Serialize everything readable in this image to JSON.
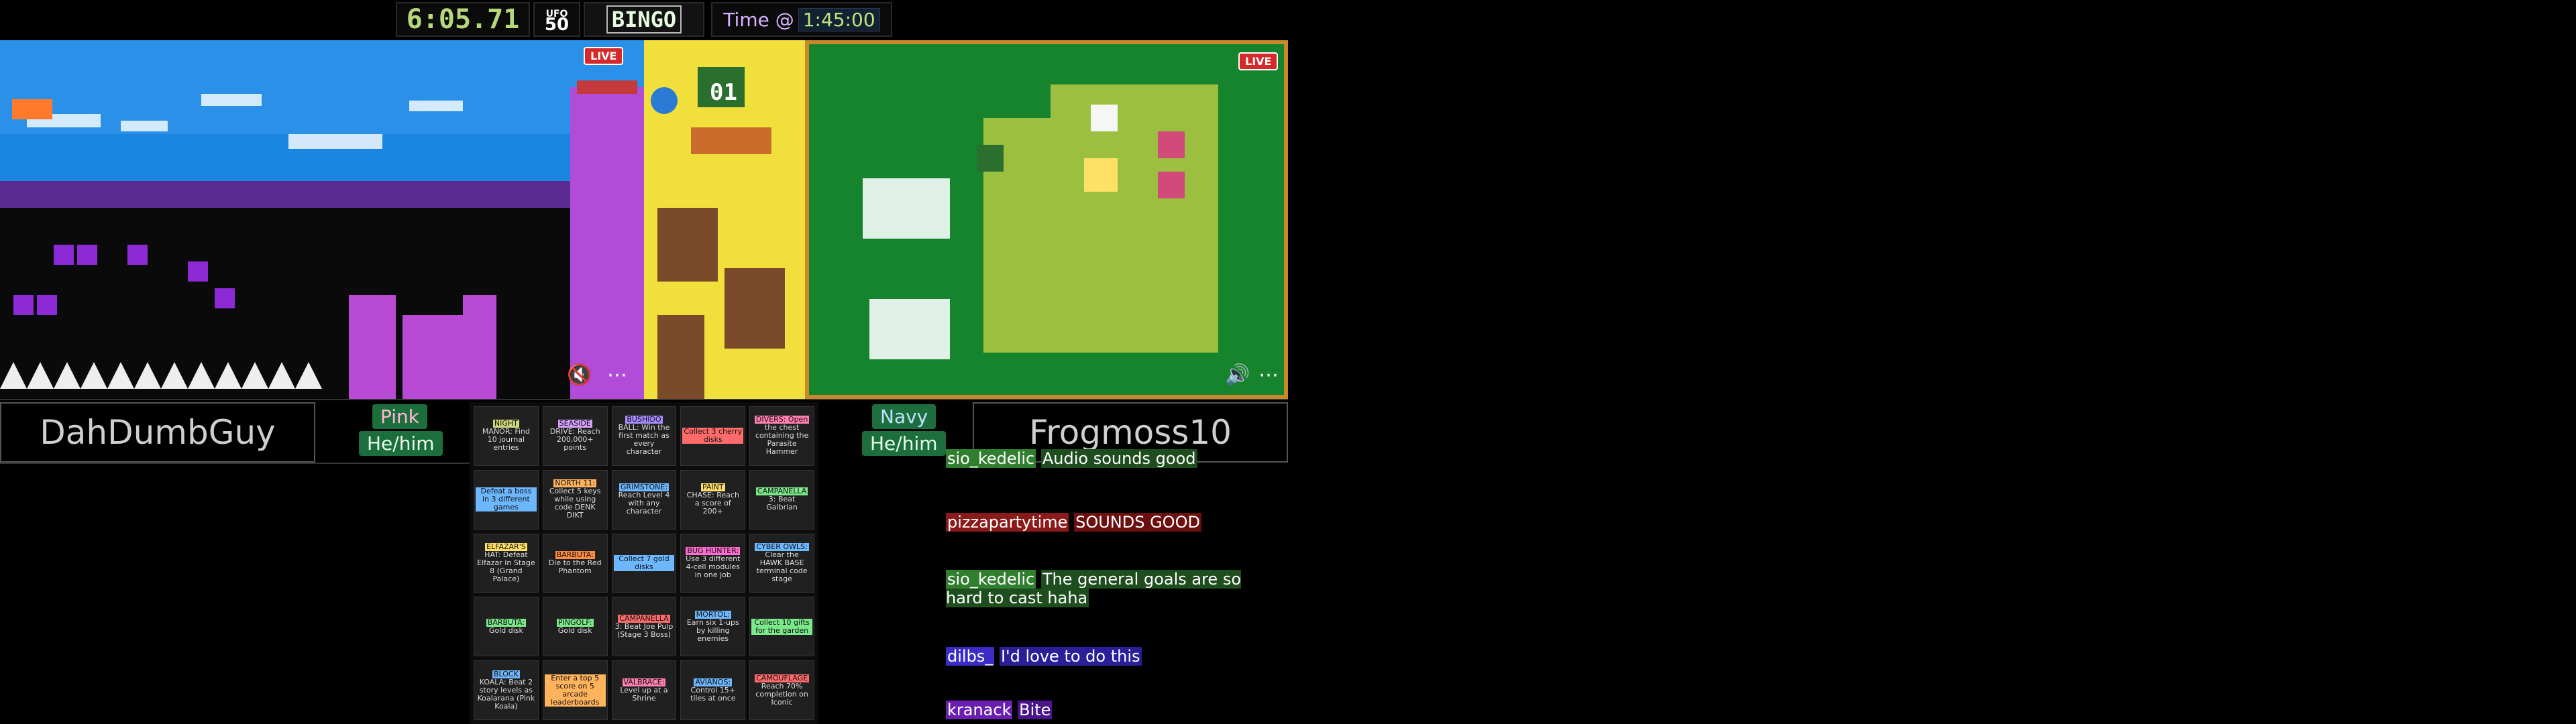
{
  "topbar": {
    "timer": "6:05.71",
    "logo": {
      "line1": "UFO",
      "line2": "50"
    },
    "title": "BINGO",
    "race_label": "Time @",
    "race_time": "1:45:00"
  },
  "games": {
    "left": {
      "live": "LIVE"
    },
    "right": {
      "live": "LIVE"
    },
    "middle": {
      "counter": "01"
    }
  },
  "players": {
    "left": {
      "name": "DahDumbGuy",
      "color": "Pink",
      "pronouns": "He/him"
    },
    "right": {
      "name": "Frogmoss10",
      "color": "Navy",
      "pronouns": "He/him"
    }
  },
  "board": {
    "cells": [
      {
        "title": "NIGHT",
        "body": "MANOR: Find 10 journal entries",
        "color": "#cfd87a"
      },
      {
        "title": "SEASIDE",
        "body": "DRIVE: Reach 200,000+ points",
        "color": "#d8a1ff"
      },
      {
        "title": "BUSHIDO",
        "body": "BALL: Win the first match as every character",
        "color": "#a78bff"
      },
      {
        "title": "",
        "body": "Collect 3 cherry disks",
        "color": "#ff6b6b"
      },
      {
        "title": "DIVERS: Open",
        "body": "the chest containing the Parasite Hammer",
        "color": "#ff7fb0"
      },
      {
        "title": "",
        "body": "Defeat a boss in 3 different games",
        "color": "#6db7ff"
      },
      {
        "title": "NORTH 11:",
        "body": "Collect 5 keys while using code DENK DIKT",
        "color": "#ffb35c"
      },
      {
        "title": "GRIMSTONE:",
        "body": "Reach Level 4 with any character",
        "color": "#6db7ff"
      },
      {
        "title": "PAINT",
        "body": "CHASE: Reach a score of 200+",
        "color": "#ffe066"
      },
      {
        "title": "CAMPANELLA",
        "body": "3: Beat Galbrian",
        "color": "#7be88a"
      },
      {
        "title": "ELFAZAR'S",
        "body": "HAT: Defeat Elfazar in Stage 8 (Grand Palace)",
        "color": "#ffe066"
      },
      {
        "title": "BARBUTA:",
        "body": "Die to the Red Phantom",
        "color": "#ff8c42"
      },
      {
        "title": "",
        "body": "Collect 7 gold disks",
        "color": "#6db7ff"
      },
      {
        "title": "BUG HUNTER:",
        "body": "Use 3 different 4-cell modules in one job",
        "color": "#ff6bd0"
      },
      {
        "title": "CYBER OWLS:",
        "body": "Clear the HAWK BASE terminal code stage",
        "color": "#6db7ff"
      },
      {
        "title": "BARBUTA:",
        "body": "Gold disk",
        "color": "#7be88a"
      },
      {
        "title": "PINGOLF:",
        "body": "Gold disk",
        "color": "#7be88a"
      },
      {
        "title": "CAMPANELLA",
        "body": "3: Beat Joe Pulp (Stage 3 Boss)",
        "color": "#ff6b6b"
      },
      {
        "title": "MORTOL:",
        "body": "Earn six 1-ups by killing enemies",
        "color": "#6db7ff"
      },
      {
        "title": "",
        "body": "Collect 10 gifts for the garden",
        "color": "#7be88a"
      },
      {
        "title": "BLOCK",
        "body": "KOALA: Beat 2 story levels as Koalarana (Pink Koala)",
        "color": "#6db7ff"
      },
      {
        "title": "",
        "body": "Enter a top 5 score on 5 arcade leaderboards",
        "color": "#ffb35c"
      },
      {
        "title": "VALBRACE:",
        "body": "Level up at a Shrine",
        "color": "#ff7fb0"
      },
      {
        "title": "AVIANOS:",
        "body": "Control 15+ tiles at once",
        "color": "#6db7ff"
      },
      {
        "title": "CAMOUFLAGE",
        "body": "Reach 70% completion on Iconic",
        "color": "#ff6b6b"
      }
    ]
  },
  "chat": {
    "messages": [
      {
        "user": "sio_kedelic",
        "text": "Audio sounds good",
        "user_color": "#2f7f2f",
        "text_bg": "#1e4d1e"
      },
      {
        "user": "pizzapartytime",
        "text": "SOUNDS GOOD",
        "user_color": "#8b1a1a",
        "text_bg": "#6b0f0f"
      },
      {
        "user": "sio_kedelic",
        "text": "The general goals are so hard to cast haha",
        "user_color": "#2f7f2f",
        "text_bg": "#1e4d1e"
      },
      {
        "user": "dilbs_",
        "text": "I'd love to do this",
        "user_color": "#3b2cc7",
        "text_bg": "#2a1f99"
      },
      {
        "user": "kranack",
        "text": "Bite",
        "user_color": "#6a1fb0",
        "text_bg": "#4a158a"
      }
    ]
  }
}
